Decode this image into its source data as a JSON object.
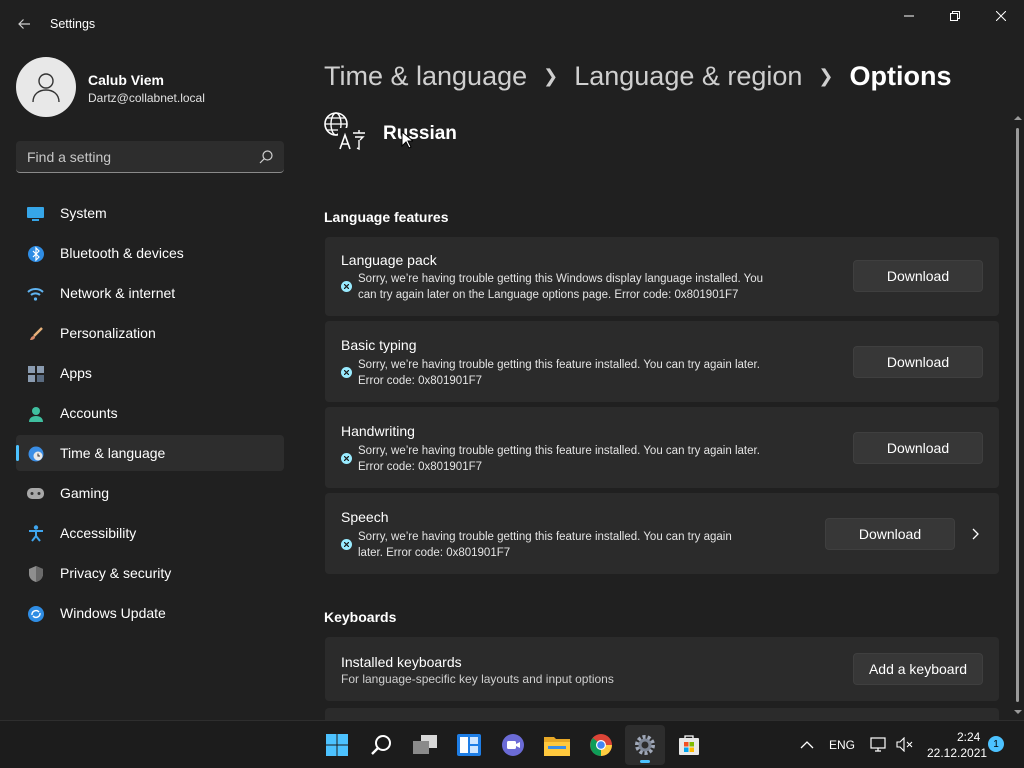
{
  "window": {
    "title": "Settings"
  },
  "profile": {
    "name": "Calub Viem",
    "email": "Dartz@collabnet.local"
  },
  "search": {
    "placeholder": "Find a setting"
  },
  "sidebar": {
    "items": [
      {
        "label": "System",
        "icon": "monitor-icon"
      },
      {
        "label": "Bluetooth & devices",
        "icon": "bluetooth-icon"
      },
      {
        "label": "Network & internet",
        "icon": "wifi-icon"
      },
      {
        "label": "Personalization",
        "icon": "brush-icon"
      },
      {
        "label": "Apps",
        "icon": "apps-icon"
      },
      {
        "label": "Accounts",
        "icon": "person-icon"
      },
      {
        "label": "Time & language",
        "icon": "globe-clock-icon",
        "active": true
      },
      {
        "label": "Gaming",
        "icon": "gamepad-icon"
      },
      {
        "label": "Accessibility",
        "icon": "accessibility-icon"
      },
      {
        "label": "Privacy & security",
        "icon": "shield-icon"
      },
      {
        "label": "Windows Update",
        "icon": "update-icon"
      }
    ]
  },
  "breadcrumb": {
    "part1": "Time & language",
    "part2": "Language & region",
    "current": "Options"
  },
  "language": {
    "name": "Russian",
    "icon": "language-icon"
  },
  "features": {
    "title": "Language features",
    "items": [
      {
        "title": "Language pack",
        "error_line1": "Sorry, we’re having trouble getting this Windows display language installed. You",
        "error_line2": "can try again later on the Language options page. Error code: 0x801901F7",
        "button": "Download"
      },
      {
        "title": "Basic typing",
        "error_line1": "Sorry, we’re having trouble getting this feature installed. You can try again later.",
        "error_line2": "Error code: 0x801901F7",
        "button": "Download"
      },
      {
        "title": "Handwriting",
        "error_line1": "Sorry, we’re having trouble getting this feature installed. You can try again later.",
        "error_line2": "Error code: 0x801901F7",
        "button": "Download"
      },
      {
        "title": "Speech",
        "error_line1": "Sorry, we’re having trouble getting this feature installed. You can try again",
        "error_line2": "later. Error code: 0x801901F7",
        "button": "Download"
      }
    ]
  },
  "keyboards": {
    "title": "Keyboards",
    "installed": {
      "title": "Installed keyboards",
      "subtitle": "For language-specific key layouts and input options",
      "button": "Add a keyboard"
    }
  },
  "taskbar": {
    "apps": [
      "windows-start-icon",
      "search-icon",
      "task-view-icon",
      "widgets-icon",
      "chat-icon",
      "file-explorer-icon",
      "chrome-icon",
      "settings-icon",
      "store-icon"
    ],
    "tray": {
      "language": "ENG",
      "time": "2:24",
      "date": "22.12.2021",
      "notifications": "1"
    }
  },
  "colors": {
    "accent": "#4cc2ff",
    "background": "#202020",
    "card": "#2b2b2b"
  }
}
